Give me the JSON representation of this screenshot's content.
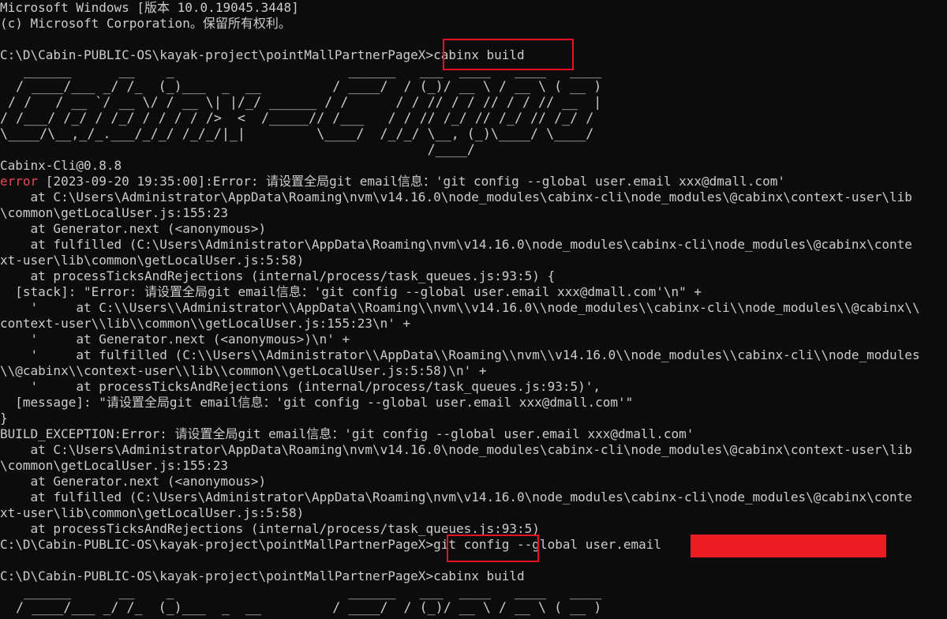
{
  "window": {
    "colors": {
      "background": "#0c0c0c",
      "text": "#cccccc",
      "error_label": "#e74856",
      "highlight_box": "#e81123",
      "redaction": "#ed1c24"
    }
  },
  "terminal": {
    "lines": [
      {
        "text": "Microsoft Windows [版本 10.0.19045.3448]"
      },
      {
        "text": "(c) Microsoft Corporation。保留所有权利。"
      },
      {
        "text": ""
      },
      {
        "text": "C:\\D\\Cabin-PUBLIC-OS\\kayak-project\\pointMallPartnerPageX>cabinx build"
      },
      {
        "text": "   ______      __    _                      ______   ___  ____   ____   ____",
        "art": true
      },
      {
        "text": "  / ____/___ _/ /_  (_)___  _  __         / ____/  / (_)/ __ \\ / __ \\ ( __ )",
        "art": true
      },
      {
        "text": " / /   / __ `/ __ \\/ / __ \\| |/_/ ______ / /      / / // / / // / / // __  |",
        "art": true
      },
      {
        "text": "/ /___/ /_/ / /_/ / / / / />  <  /_____// /___   / / // /_/ // /_/ // /_/ /",
        "art": true
      },
      {
        "text": "\\____/\\__,_/_.___/_/_/ /_/_/|_|         \\____/  /_/_/ \\__, (_)\\____/ \\____/",
        "art": true
      },
      {
        "text": "                                                      /____/",
        "art": true
      },
      {
        "text": "Cabinx-Cli@0.8.8"
      },
      {
        "prefix": "error",
        "text": " [2023-09-20 19:35:00]:Error: 请设置全局git email信息：'git config --global user.email xxx@dmall.com'"
      },
      {
        "text": "    at C:\\Users\\Administrator\\AppData\\Roaming\\nvm\\v14.16.0\\node_modules\\cabinx-cli\\node_modules\\@cabinx\\context-user\\lib"
      },
      {
        "text": "\\common\\getLocalUser.js:155:23"
      },
      {
        "text": "    at Generator.next (<anonymous>)"
      },
      {
        "text": "    at fulfilled (C:\\Users\\Administrator\\AppData\\Roaming\\nvm\\v14.16.0\\node_modules\\cabinx-cli\\node_modules\\@cabinx\\conte"
      },
      {
        "text": "xt-user\\lib\\common\\getLocalUser.js:5:58)"
      },
      {
        "text": "    at processTicksAndRejections (internal/process/task_queues.js:93:5) {"
      },
      {
        "text": "  [stack]: \"Error: 请设置全局git email信息：'git config --global user.email xxx@dmall.com'\\n\" +"
      },
      {
        "text": "    '     at C:\\\\Users\\\\Administrator\\\\AppData\\\\Roaming\\\\nvm\\\\v14.16.0\\\\node_modules\\\\cabinx-cli\\\\node_modules\\\\@cabinx\\\\"
      },
      {
        "text": "context-user\\\\lib\\\\common\\\\getLocalUser.js:155:23\\n' +"
      },
      {
        "text": "    '     at Generator.next (<anonymous>)\\n' +"
      },
      {
        "text": "    '     at fulfilled (C:\\\\Users\\\\Administrator\\\\AppData\\\\Roaming\\\\nvm\\\\v14.16.0\\\\node_modules\\\\cabinx-cli\\\\node_modules"
      },
      {
        "text": "\\\\@cabinx\\\\context-user\\\\lib\\\\common\\\\getLocalUser.js:5:58)\\n' +"
      },
      {
        "text": "    '     at processTicksAndRejections (internal/process/task_queues.js:93:5)',"
      },
      {
        "text": "  [message]: \"请设置全局git email信息：'git config --global user.email xxx@dmall.com'\""
      },
      {
        "text": "}"
      },
      {
        "text": "BUILD_EXCEPTION:Error: 请设置全局git email信息：'git config --global user.email xxx@dmall.com'"
      },
      {
        "text": "    at C:\\Users\\Administrator\\AppData\\Roaming\\nvm\\v14.16.0\\node_modules\\cabinx-cli\\node_modules\\@cabinx\\context-user\\lib"
      },
      {
        "text": "\\common\\getLocalUser.js:155:23"
      },
      {
        "text": "    at Generator.next (<anonymous>)"
      },
      {
        "text": "    at fulfilled (C:\\Users\\Administrator\\AppData\\Roaming\\nvm\\v14.16.0\\node_modules\\cabinx-cli\\node_modules\\@cabinx\\conte"
      },
      {
        "text": "xt-user\\lib\\common\\getLocalUser.js:5:58)"
      },
      {
        "text": "    at processTicksAndRejections (internal/process/task_queues.js:93:5)"
      },
      {
        "text": "C:\\D\\Cabin-PUBLIC-OS\\kayak-project\\pointMallPartnerPageX>git config --global user.email"
      },
      {
        "text": ""
      },
      {
        "text": "C:\\D\\Cabin-PUBLIC-OS\\kayak-project\\pointMallPartnerPageX>cabinx build"
      },
      {
        "text": "   ______      __    _                      ______   ___  ____   ____   ____",
        "art": true
      },
      {
        "text": "  / ____/___ _/ /_  (_)___  _  __         / ____/  / (_)/ __ \\ / __ \\ ( __ )",
        "art": true
      }
    ]
  }
}
